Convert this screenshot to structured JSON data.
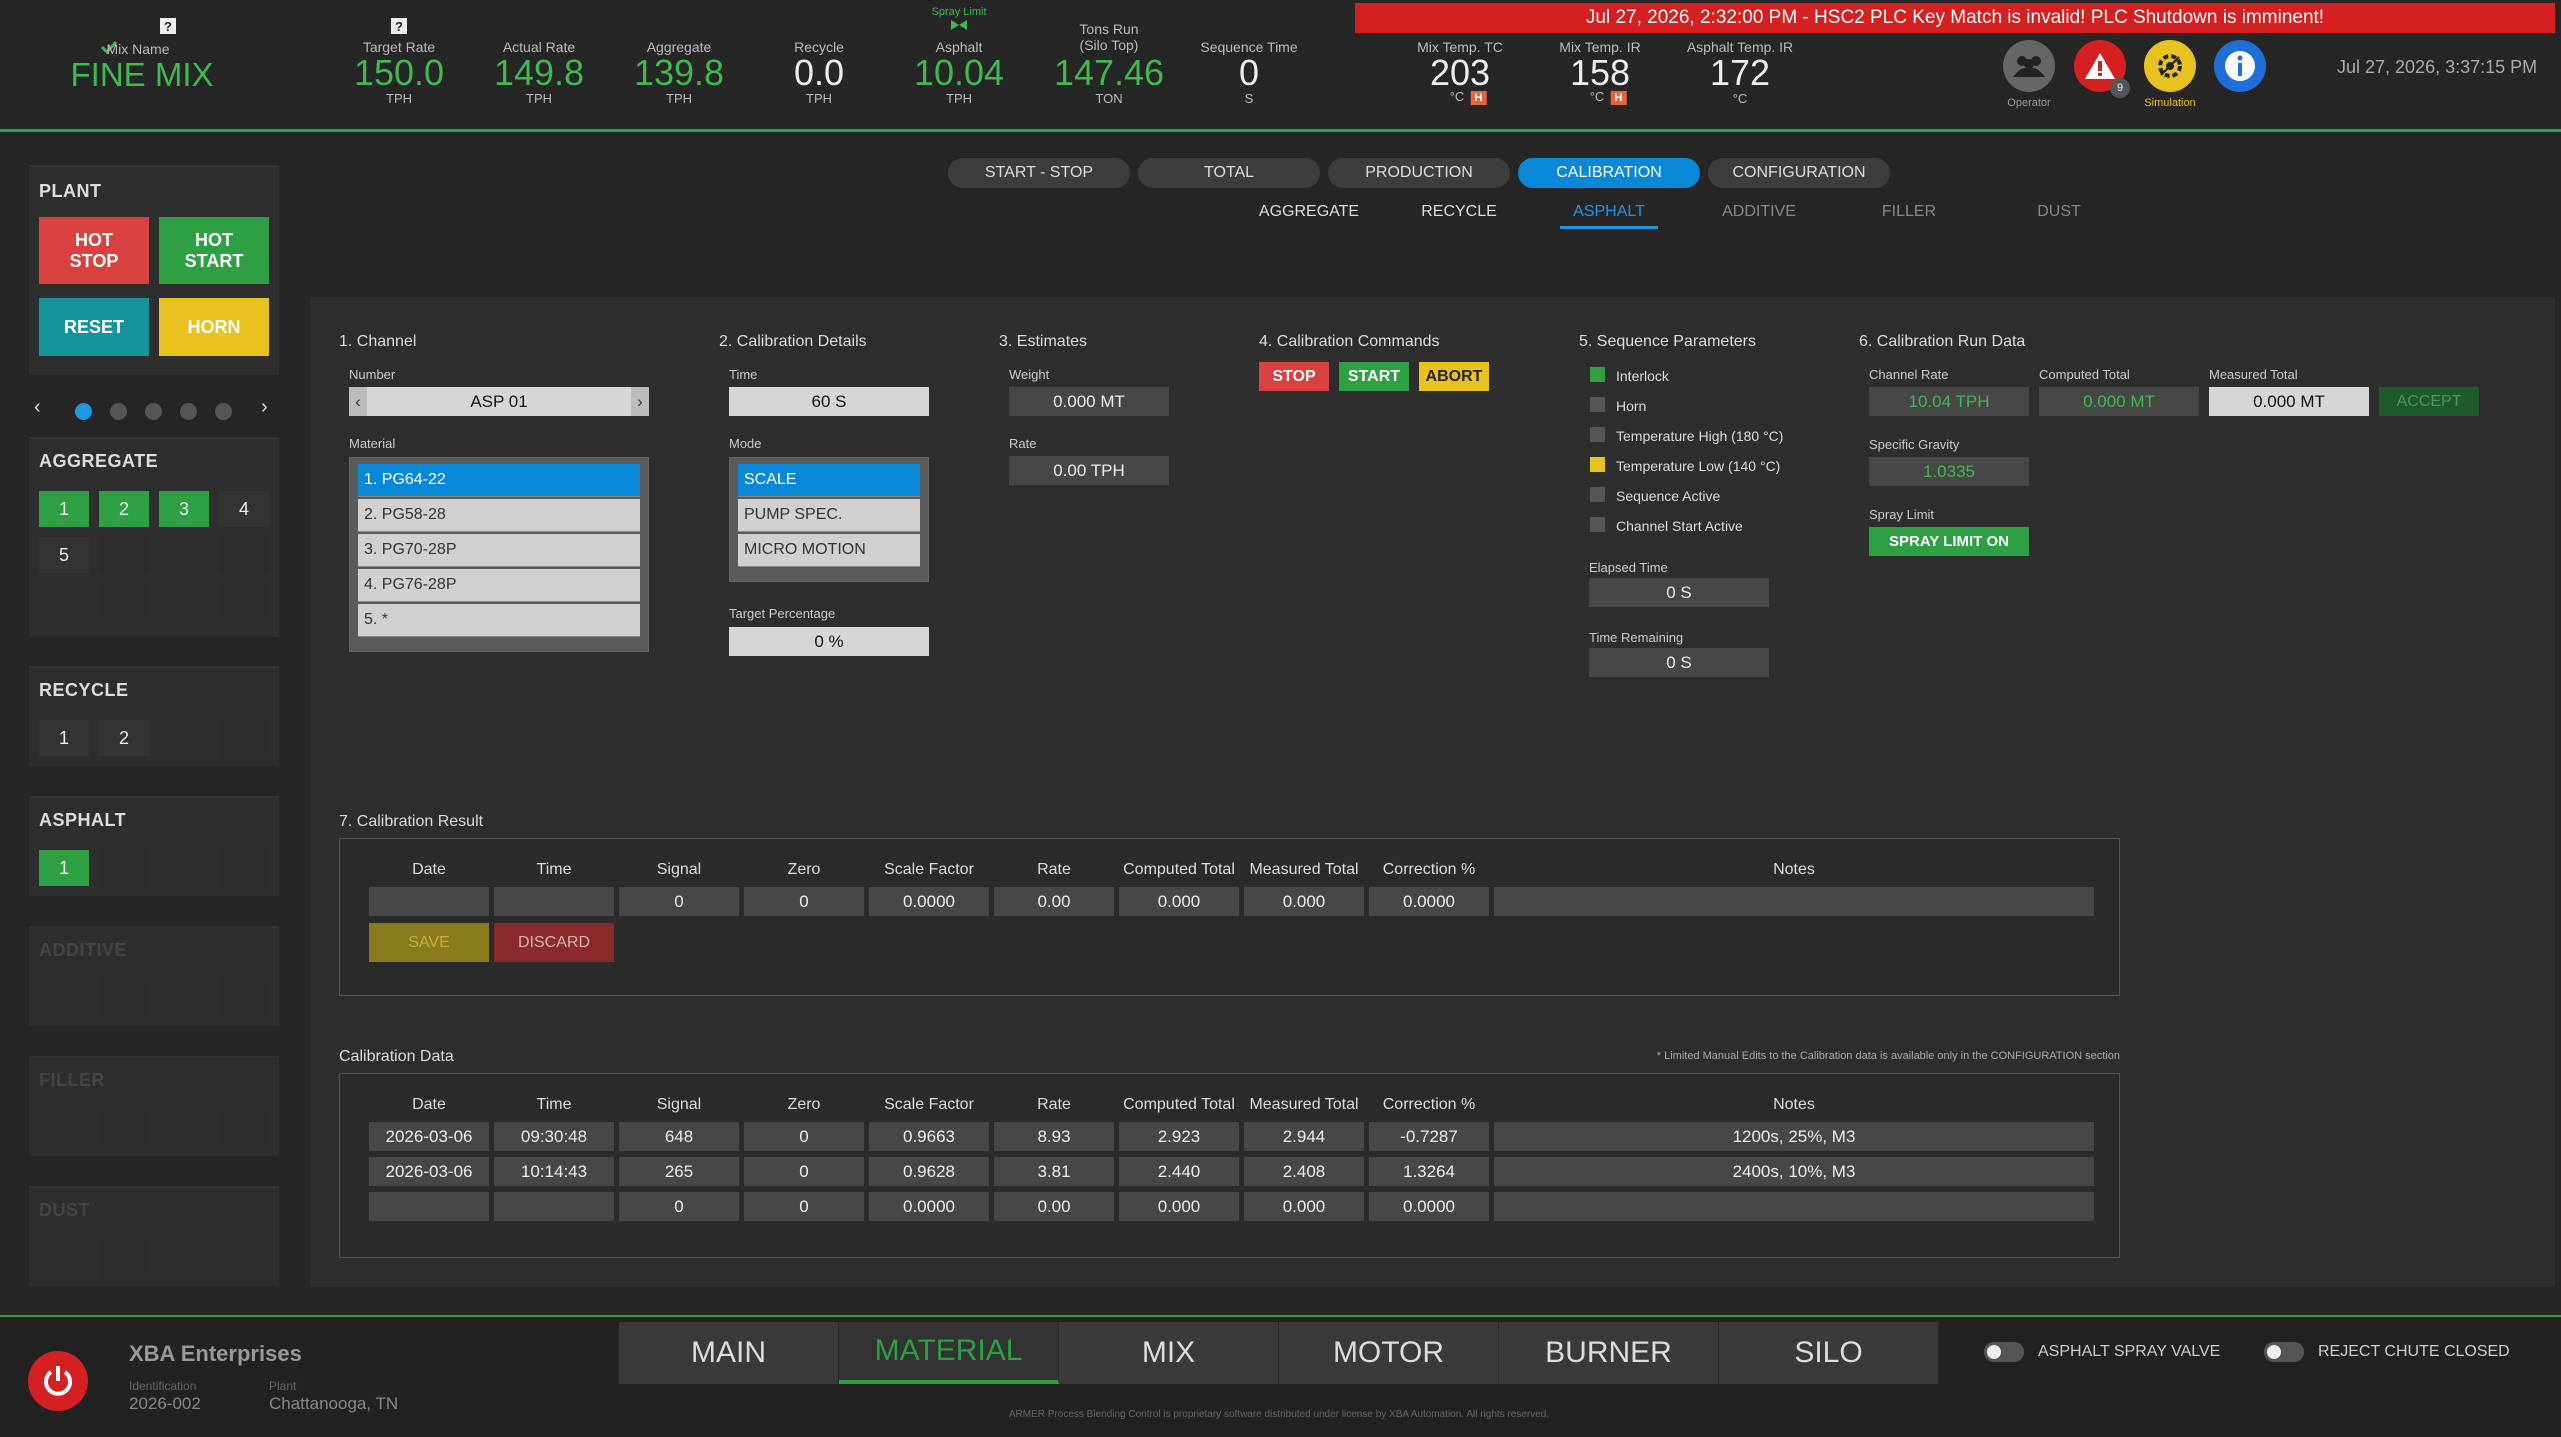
{
  "topbar": {
    "mix_name_label": "Mix Name",
    "mix_name": "FINE MIX",
    "metrics": [
      {
        "label": "Target Rate",
        "value": "150.0",
        "unit": "TPH"
      },
      {
        "label": "Actual Rate",
        "value": "149.8",
        "unit": "TPH"
      },
      {
        "label": "Aggregate",
        "value": "139.8",
        "unit": "TPH"
      },
      {
        "label": "Recycle",
        "value": "0.0",
        "unit": "TPH"
      },
      {
        "label": "Asphalt",
        "value": "10.04",
        "unit": "TPH",
        "top_note": "Spray Limit"
      },
      {
        "label": "Tons Run",
        "label2": "(Silo Top)",
        "value": "147.46",
        "unit": "TON"
      },
      {
        "label": "Sequence Time",
        "value": "0",
        "unit": "S"
      },
      {
        "label": "Mix Temp. TC",
        "value": "203",
        "unit": "°C",
        "badge": "H"
      },
      {
        "label": "Mix Temp. IR",
        "value": "158",
        "unit": "°C",
        "badge": "H"
      },
      {
        "label": "Asphalt Temp. IR",
        "value": "172",
        "unit": "°C"
      }
    ],
    "alarm": "Jul 27, 2026, 2:32:00 PM - HSC2 PLC Key Match is invalid! PLC Shutdown is imminent!",
    "operator_label": "Operator",
    "alarm_count": "9",
    "simulation_label": "Simulation",
    "datetime": "Jul 27, 2026, 3:37:15 PM",
    "colors": {
      "accent_green": "#3fb950",
      "alarm_red": "#d42020",
      "sim_yellow": "#e8c21e",
      "info_blue": "#1f6fd8"
    }
  },
  "sidebar": {
    "plant": {
      "title": "PLANT",
      "hot_stop": "HOT STOP",
      "hot_start": "HOT START",
      "reset": "RESET",
      "horn": "HORN"
    },
    "aggregate": {
      "title": "AGGREGATE",
      "cells": [
        "1",
        "2",
        "3",
        "4",
        "5"
      ]
    },
    "recycle": {
      "title": "RECYCLE",
      "cells": [
        "1",
        "2"
      ]
    },
    "asphalt": {
      "title": "ASPHALT",
      "cells": [
        "1"
      ]
    },
    "additive": {
      "title": "ADDITIVE"
    },
    "filler": {
      "title": "FILLER"
    },
    "dust": {
      "title": "DUST"
    }
  },
  "tabs": [
    "START - STOP",
    "TOTAL",
    "PRODUCTION",
    "CALIBRATION",
    "CONFIGURATION"
  ],
  "subtabs": [
    "AGGREGATE",
    "RECYCLE",
    "ASPHALT",
    "ADDITIVE",
    "FILLER",
    "DUST"
  ],
  "channel": {
    "title": "1. Channel",
    "number_label": "Number",
    "number": "ASP 01",
    "material_label": "Material",
    "materials": [
      "1. PG64-22",
      "2. PG58-28",
      "3. PG70-28P",
      "4. PG76-28P",
      "5. *"
    ]
  },
  "details": {
    "title": "2. Calibration Details",
    "time_label": "Time",
    "time": "60 S",
    "mode_label": "Mode",
    "modes": [
      "SCALE",
      "PUMP SPEC.",
      "MICRO MOTION"
    ],
    "target_label": "Target Percentage",
    "target": "0 %"
  },
  "estimates": {
    "title": "3. Estimates",
    "weight_label": "Weight",
    "weight": "0.000 MT",
    "rate_label": "Rate",
    "rate": "0.00 TPH"
  },
  "commands": {
    "title": "4. Calibration Commands",
    "stop": "STOP",
    "start": "START",
    "abort": "ABORT"
  },
  "sequence": {
    "title": "5. Sequence Parameters",
    "items": [
      "Interlock",
      "Horn",
      "Temperature High (180 °C)",
      "Temperature Low (140 °C)",
      "Sequence Active",
      "Channel Start Active"
    ],
    "elapsed_label": "Elapsed Time",
    "elapsed": "0 S",
    "remaining_label": "Time Remaining",
    "remaining": "0 S"
  },
  "run": {
    "title": "6. Calibration Run Data",
    "channel_rate_label": "Channel Rate",
    "channel_rate": "10.04 TPH",
    "computed_label": "Computed Total",
    "computed": "0.000 MT",
    "measured_label": "Measured Total",
    "measured": "0.000 MT",
    "accept": "ACCEPT",
    "sg_label": "Specific Gravity",
    "sg": "1.0335",
    "spray_label": "Spray Limit",
    "spray": "SPRAY LIMIT ON"
  },
  "result": {
    "title": "7. Calibration Result",
    "headers": [
      "Date",
      "Time",
      "Signal",
      "Zero",
      "Scale Factor",
      "Rate",
      "Computed Total",
      "Measured Total",
      "Correction %",
      "Notes"
    ],
    "row": [
      "",
      "",
      "0",
      "0",
      "0.0000",
      "0.00",
      "0.000",
      "0.000",
      "0.0000",
      ""
    ],
    "save": "SAVE",
    "discard": "DISCARD"
  },
  "caldata": {
    "title": "Calibration Data",
    "note": "* Limited Manual Edits to the Calibration data is available only in the CONFIGURATION section",
    "headers": [
      "Date",
      "Time",
      "Signal",
      "Zero",
      "Scale Factor",
      "Rate",
      "Computed Total",
      "Measured Total",
      "Correction %",
      "Notes"
    ],
    "rows": [
      [
        "2026-03-06",
        "09:30:48",
        "648",
        "0",
        "0.9663",
        "8.93",
        "2.923",
        "2.944",
        "-0.7287",
        "1200s, 25%, M3"
      ],
      [
        "2026-03-06",
        "10:14:43",
        "265",
        "0",
        "0.9628",
        "3.81",
        "2.440",
        "2.408",
        "1.3264",
        "2400s, 10%, M3"
      ],
      [
        "",
        "",
        "0",
        "0",
        "0.0000",
        "0.00",
        "0.000",
        "0.000",
        "0.0000",
        ""
      ]
    ]
  },
  "footer": {
    "company": "XBA Enterprises",
    "id_label": "Identification",
    "id": "2026-002",
    "plant_label": "Plant",
    "plant": "Chattanooga, TN",
    "nav": [
      "MAIN",
      "MATERIAL",
      "MIX",
      "MOTOR",
      "BURNER",
      "SILO"
    ],
    "toggle1": "ASPHALT SPRAY VALVE",
    "toggle2": "REJECT CHUTE CLOSED",
    "copyright": "ARMER Process Blending Control is proprietary software distributed under license by XBA Automation. All rights reserved."
  }
}
